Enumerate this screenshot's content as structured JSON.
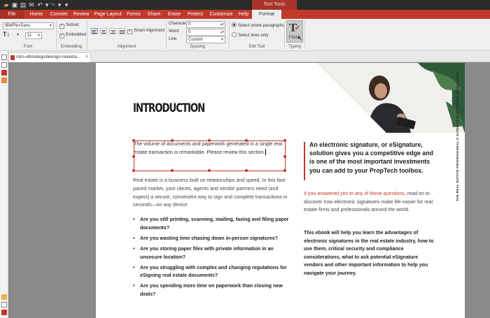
{
  "titlebar": {
    "context_tab": "Text Tools"
  },
  "menu": {
    "tabs": [
      "File",
      "Home",
      "Convert",
      "Review",
      "Page Layout",
      "Forms",
      "Share",
      "Erase",
      "Protect",
      "Customize",
      "Help",
      "Format"
    ],
    "active_tab": "Format"
  },
  "ribbon": {
    "font": {
      "family": "IBMPlexSans",
      "size": "11",
      "label": "Font"
    },
    "embedding": {
      "subset_label": "Subset",
      "embedded_label": "Embedded",
      "label": "Embedding"
    },
    "alignment": {
      "smart_alignment_label": "Smart Alignment",
      "label": "Alignment"
    },
    "spacing": {
      "character_label": "Character",
      "character_value": "0",
      "word_label": "Word",
      "word_value": "0",
      "line_label": "Line",
      "line_value": "Custom",
      "label": "Spacing"
    },
    "edit_tool": {
      "whole_paragraphs_label": "Select whole paragraphs",
      "lines_only_label": "Select lines only",
      "label": "Edit Tool"
    },
    "typing": {
      "finish_label": "Finish",
      "label": "Typing"
    }
  },
  "document_tab": {
    "title": "nitro-ultimateguideesign-realesta..."
  },
  "page": {
    "vertical_text": "THE REAL ESTATE PROFESSIONAL'S GUIDE TO ELECTRONIC SIGNATURES",
    "heading": "INTRODUCTION",
    "edited_text": "The volume of documents and paperwork generated in a single real estate transaction is remarkable. Please review this section.",
    "body_paragraph": "Real estate is a business built on relationships and speed. In this fast-paced market, your clients, agents and vendor partners need (and expect) a secure, convenient way to sign and complete transactions in seconds—on any device.",
    "bullets": [
      "Are you still printing, scanning, mailing, faxing and filing paper documents?",
      "Are you wasting time chasing down in-person signatures?",
      "Are you storing paper files with private information in an unsecure location?",
      "Are you struggling with complex and changing regulations for eSigning real estate documents?",
      "Are you spending more time on paperwork than closing new deals?"
    ],
    "callout": "An electronic signature, or eSignature, solution gives you a competitive edge and is one of the most important investments you can add to your PropTech toolbox.",
    "para2_highlight": "If you answered yes to any of these questions,",
    "para2_rest": " read on to discover how electronic signatures make life easier for real estate firms and professionals around the world.",
    "para3": "This ebook will help you learn the advantages of electronic signatures in the real estate industry, how to use them, critical security and compliance considerations, what to ask potential eSignature vendors and other important information to help you navigate your journey."
  },
  "colors": {
    "accent": "#c0392b",
    "tab_bar": "#c0392b",
    "title_bar": "#2b2b2b",
    "ribbon": "#efefef"
  }
}
